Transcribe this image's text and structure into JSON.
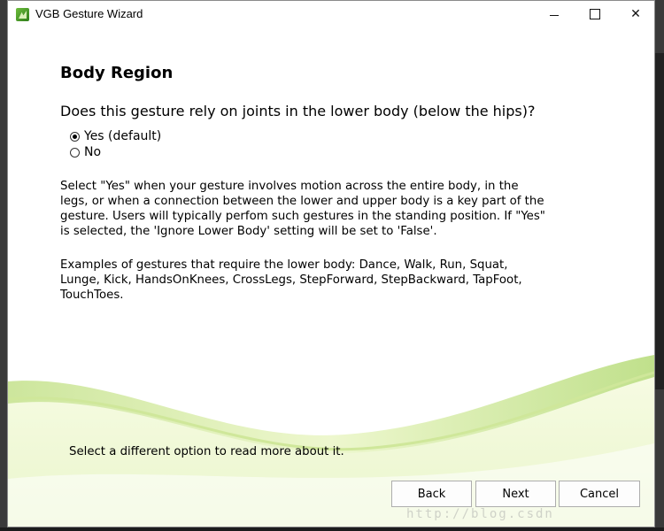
{
  "window": {
    "title": "VGB Gesture Wizard",
    "controls": {
      "minimize": "minimize",
      "maximize": "maximize",
      "close": "✕"
    }
  },
  "page": {
    "heading": "Body Region",
    "question": "Does this gesture rely on joints in the lower body (below the hips)?",
    "options": [
      {
        "label": "Yes (default)",
        "selected": true
      },
      {
        "label": "No",
        "selected": false
      }
    ],
    "description": [
      "Select \"Yes\" when your gesture involves motion across the entire body, in the",
      "legs, or when a connection between the lower and upper body is a key part of the",
      "gesture. Users will typically perfom such gestures in the standing position. If \"Yes\"",
      "is selected, the 'Ignore Lower Body' setting will be set to 'False'."
    ],
    "examples": [
      "Examples of gestures that require the lower body: Dance, Walk, Run, Squat,",
      "Lunge, Kick, HandsOnKnees, CrossLegs, StepForward, StepBackward, TapFoot,",
      "TouchToes."
    ],
    "hint": "Select a different option to read more about it."
  },
  "buttons": {
    "back": "Back",
    "next": "Next",
    "cancel": "Cancel"
  },
  "watermark": "http://blog.csdn",
  "colors": {
    "wave_light": "#eef7c8",
    "wave_mid": "#c9e58a",
    "wave_dark": "#8fc94a"
  }
}
